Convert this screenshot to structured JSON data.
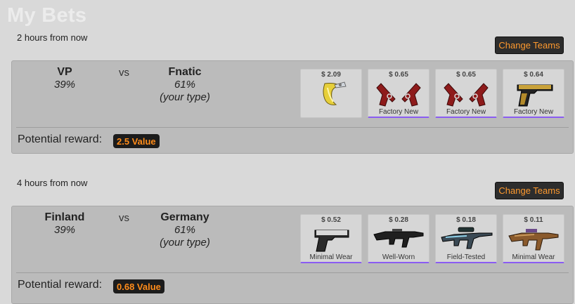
{
  "page": {
    "title": "My Bets"
  },
  "change_teams_label": "Change Teams",
  "potential_reward_label": "Potential reward:",
  "vs_label": "vs",
  "matches": [
    {
      "time": "2 hours from now",
      "team1": {
        "name": "VP",
        "percent": "39%"
      },
      "team2": {
        "name": "Fnatic",
        "percent": "61%",
        "note": "(your type)"
      },
      "reward": "2.5 Value",
      "items": [
        {
          "price": "$ 2.09",
          "condition": "",
          "icon": "banana-sticker-icon"
        },
        {
          "price": "$ 0.65",
          "condition": "Factory New",
          "icon": "dual-berettas-red-icon"
        },
        {
          "price": "$ 0.65",
          "condition": "Factory New",
          "icon": "dual-berettas-red-icon"
        },
        {
          "price": "$ 0.64",
          "condition": "Factory New",
          "icon": "pistol-gold-icon"
        }
      ]
    },
    {
      "time": "4 hours from now",
      "team1": {
        "name": "Finland",
        "percent": "39%"
      },
      "team2": {
        "name": "Germany",
        "percent": "61%",
        "note": "(your type)"
      },
      "reward": "0.68 Value",
      "items": [
        {
          "price": "$ 0.52",
          "condition": "Minimal Wear",
          "icon": "pistol-silver-icon"
        },
        {
          "price": "$ 0.28",
          "condition": "Well-Worn",
          "icon": "rifle-black-icon"
        },
        {
          "price": "$ 0.18",
          "condition": "Field-Tested",
          "icon": "sniper-rifle-icon"
        },
        {
          "price": "$ 0.11",
          "condition": "Minimal Wear",
          "icon": "rifle-copper-icon"
        }
      ]
    }
  ]
}
